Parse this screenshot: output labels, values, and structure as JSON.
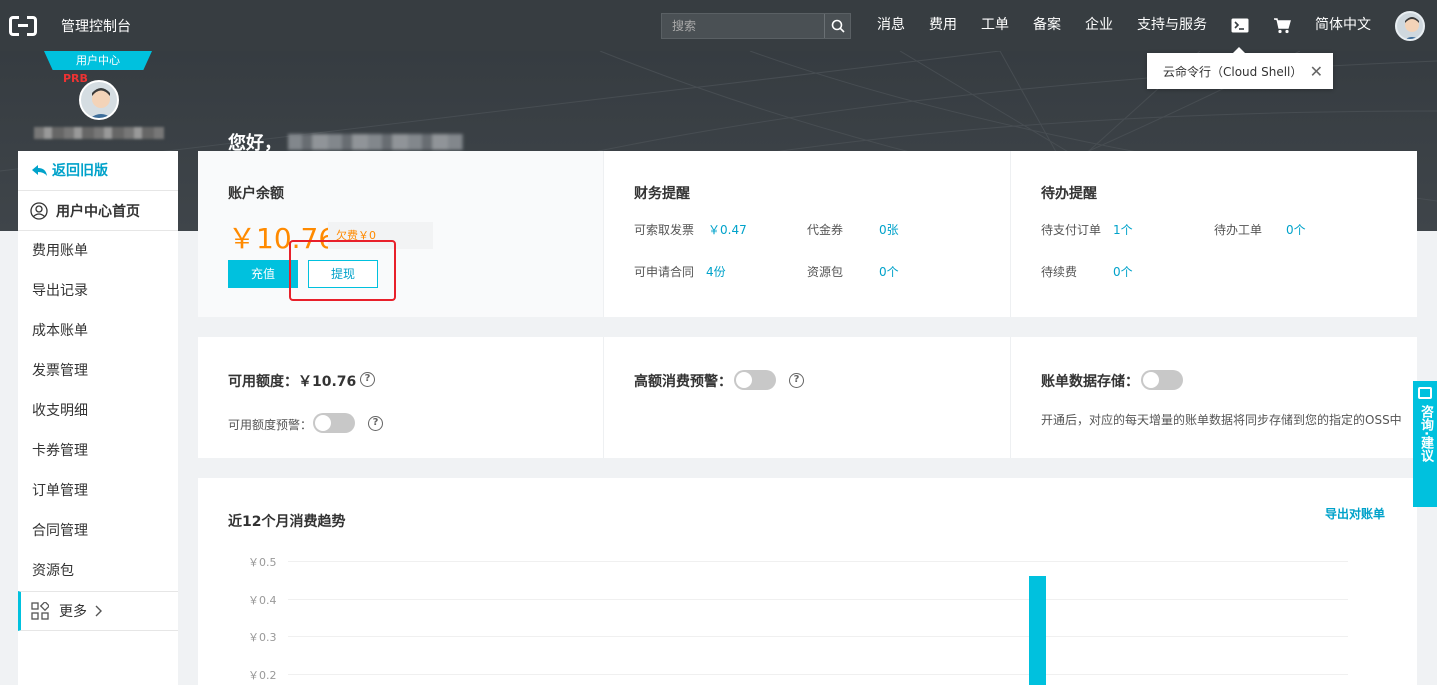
{
  "topnav": {
    "title": "管理控制台",
    "search_placeholder": "搜索",
    "items": [
      "消息",
      "费用",
      "工单",
      "备案",
      "企业",
      "支持与服务"
    ],
    "language": "简体中文",
    "icons": [
      "terminal-icon",
      "cart-icon"
    ]
  },
  "tooltip": {
    "text": "云命令行（Cloud Shell）",
    "close": "✕"
  },
  "hero": {
    "greeting": "您好，"
  },
  "user_card": {
    "ribbon": "用户中心",
    "badge": "PRB"
  },
  "sidebar": {
    "back": "返回旧版",
    "home": "用户中心首页",
    "items": [
      "费用账单",
      "导出记录",
      "成本账单",
      "发票管理",
      "收支明细",
      "卡券管理",
      "订单管理",
      "合同管理",
      "资源包"
    ],
    "more": "更多"
  },
  "account": {
    "title": "账户余额",
    "balance": "￥10.76",
    "arrears": "欠费￥0",
    "recharge": "充值",
    "withdraw": "提现"
  },
  "finance": {
    "title": "财务提醒",
    "invoice_label": "可索取发票",
    "invoice_value": "￥0.47",
    "voucher_label": "代金券",
    "voucher_value": "0张",
    "contract_label": "可申请合同",
    "contract_value": "4份",
    "package_label": "资源包",
    "package_value": "0个"
  },
  "todo": {
    "title": "待办提醒",
    "pending_order_label": "待支付订单",
    "pending_order_value": "1个",
    "ticket_label": "待办工单",
    "ticket_value": "0个",
    "renew_label": "待续费",
    "renew_value": "0个"
  },
  "credit": {
    "title": "可用额度：￥10.76",
    "alert_label": "可用额度预警：",
    "high_alert_label": "高额消费预警：",
    "storage_label": "账单数据存储：",
    "storage_desc": "开通后，对应的每天增量的账单数据将同步存储到您的指定的OSS中"
  },
  "trend": {
    "title": "近12个月消费趋势",
    "export": "导出对账单"
  },
  "chart_data": {
    "type": "bar",
    "y_ticks": [
      "￥0.5",
      "￥0.4",
      "￥0.3",
      "￥0.2"
    ],
    "ylim": [
      0,
      0.5
    ],
    "values": [
      0.46
    ]
  },
  "feedback": {
    "label": "咨询·建议"
  },
  "colors": {
    "accent": "#00c1de",
    "balance": "#ff8a00",
    "nav": "#373d41",
    "highlight": "#e8202a"
  }
}
